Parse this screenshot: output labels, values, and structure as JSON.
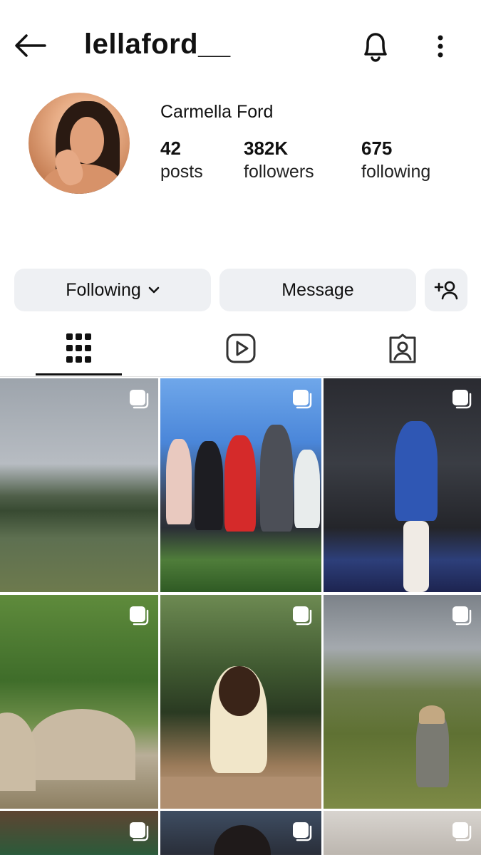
{
  "header": {
    "username": "lellaford__",
    "back_icon": "arrow-left-icon",
    "bell_icon": "bell-icon",
    "more_icon": "more-vertical-icon"
  },
  "profile": {
    "display_name": "Carmella Ford",
    "stats": [
      {
        "value": "42",
        "label": "posts"
      },
      {
        "value": "382K",
        "label": "followers"
      },
      {
        "value": "675",
        "label": "following"
      }
    ]
  },
  "actions": {
    "following_label": "Following",
    "message_label": "Message",
    "add_user_icon": "add-user-icon"
  },
  "tabs": [
    {
      "name": "grid",
      "icon": "grid-icon",
      "active": true
    },
    {
      "name": "reels",
      "icon": "reels-icon",
      "active": false
    },
    {
      "name": "tagged",
      "icon": "tagged-icon",
      "active": false
    }
  ],
  "posts": [
    {
      "icon": "multi-photo-icon"
    },
    {
      "icon": "multi-photo-icon"
    },
    {
      "icon": "multi-photo-icon"
    },
    {
      "icon": "multi-photo-icon"
    },
    {
      "icon": "multi-photo-icon"
    },
    {
      "icon": "multi-photo-icon"
    },
    {
      "icon": "multi-photo-icon"
    },
    {
      "icon": "multi-photo-icon"
    },
    {
      "icon": "multi-photo-icon"
    }
  ],
  "colors": {
    "button_bg": "#eef0f3",
    "text": "#111111",
    "background": "#ffffff"
  }
}
